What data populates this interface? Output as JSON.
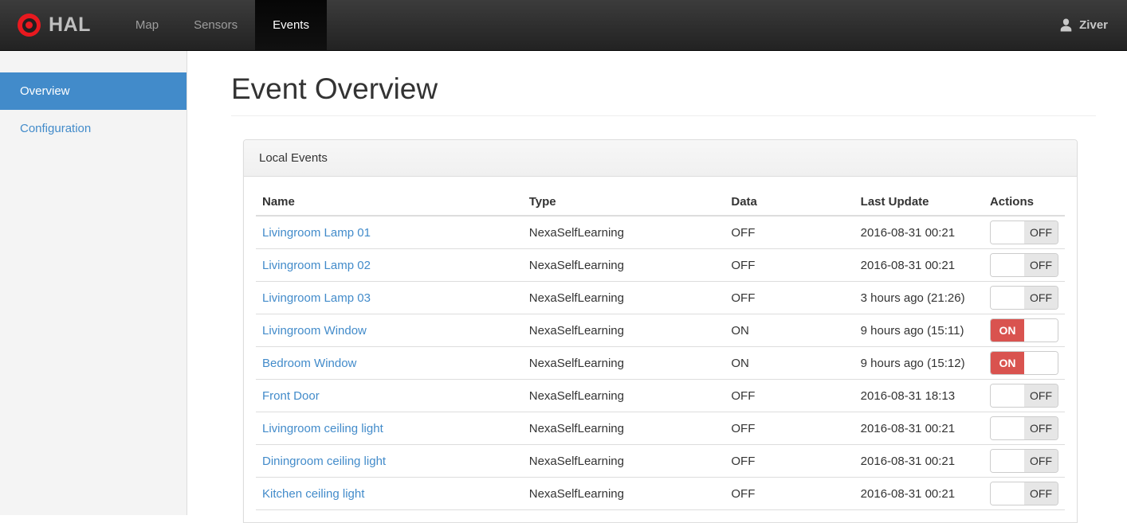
{
  "navbar": {
    "brand": "HAL",
    "items": [
      {
        "label": "Map",
        "active": false
      },
      {
        "label": "Sensors",
        "active": false
      },
      {
        "label": "Events",
        "active": true
      }
    ],
    "user": "Ziver"
  },
  "sidebar": {
    "items": [
      {
        "label": "Overview",
        "active": true
      },
      {
        "label": "Configuration",
        "active": false
      }
    ]
  },
  "main": {
    "title": "Event Overview",
    "panel": {
      "title": "Local Events",
      "table": {
        "headers": [
          "Name",
          "Type",
          "Data",
          "Last Update",
          "Actions"
        ],
        "rows": [
          {
            "name": "Livingroom Lamp 01",
            "type": "NexaSelfLearning",
            "data": "OFF",
            "last_update": "2016-08-31 00:21",
            "switch": "OFF"
          },
          {
            "name": "Livingroom Lamp 02",
            "type": "NexaSelfLearning",
            "data": "OFF",
            "last_update": "2016-08-31 00:21",
            "switch": "OFF"
          },
          {
            "name": "Livingroom Lamp 03",
            "type": "NexaSelfLearning",
            "data": "OFF",
            "last_update": "3 hours ago (21:26)",
            "switch": "OFF"
          },
          {
            "name": "Livingroom Window",
            "type": "NexaSelfLearning",
            "data": "ON",
            "last_update": "9 hours ago (15:11)",
            "switch": "ON"
          },
          {
            "name": "Bedroom Window",
            "type": "NexaSelfLearning",
            "data": "ON",
            "last_update": "9 hours ago (15:12)",
            "switch": "ON"
          },
          {
            "name": "Front Door",
            "type": "NexaSelfLearning",
            "data": "OFF",
            "last_update": "2016-08-31 18:13",
            "switch": "OFF"
          },
          {
            "name": "Livingroom ceiling light",
            "type": "NexaSelfLearning",
            "data": "OFF",
            "last_update": "2016-08-31 00:21",
            "switch": "OFF"
          },
          {
            "name": "Diningroom ceiling light",
            "type": "NexaSelfLearning",
            "data": "OFF",
            "last_update": "2016-08-31 00:21",
            "switch": "OFF"
          },
          {
            "name": "Kitchen ceiling light",
            "type": "NexaSelfLearning",
            "data": "OFF",
            "last_update": "2016-08-31 00:21",
            "switch": "OFF"
          }
        ]
      }
    }
  },
  "icons": {
    "logo": "bullseye-icon",
    "user": "person-icon"
  },
  "colors": {
    "navbar_bg": "#222222",
    "navbar_active_bg": "#080808",
    "accent_blue": "#428bca",
    "toggle_on_red": "#d9534f",
    "sidebar_bg": "#f4f4f4",
    "panel_heading_bg": "#f5f5f5"
  }
}
